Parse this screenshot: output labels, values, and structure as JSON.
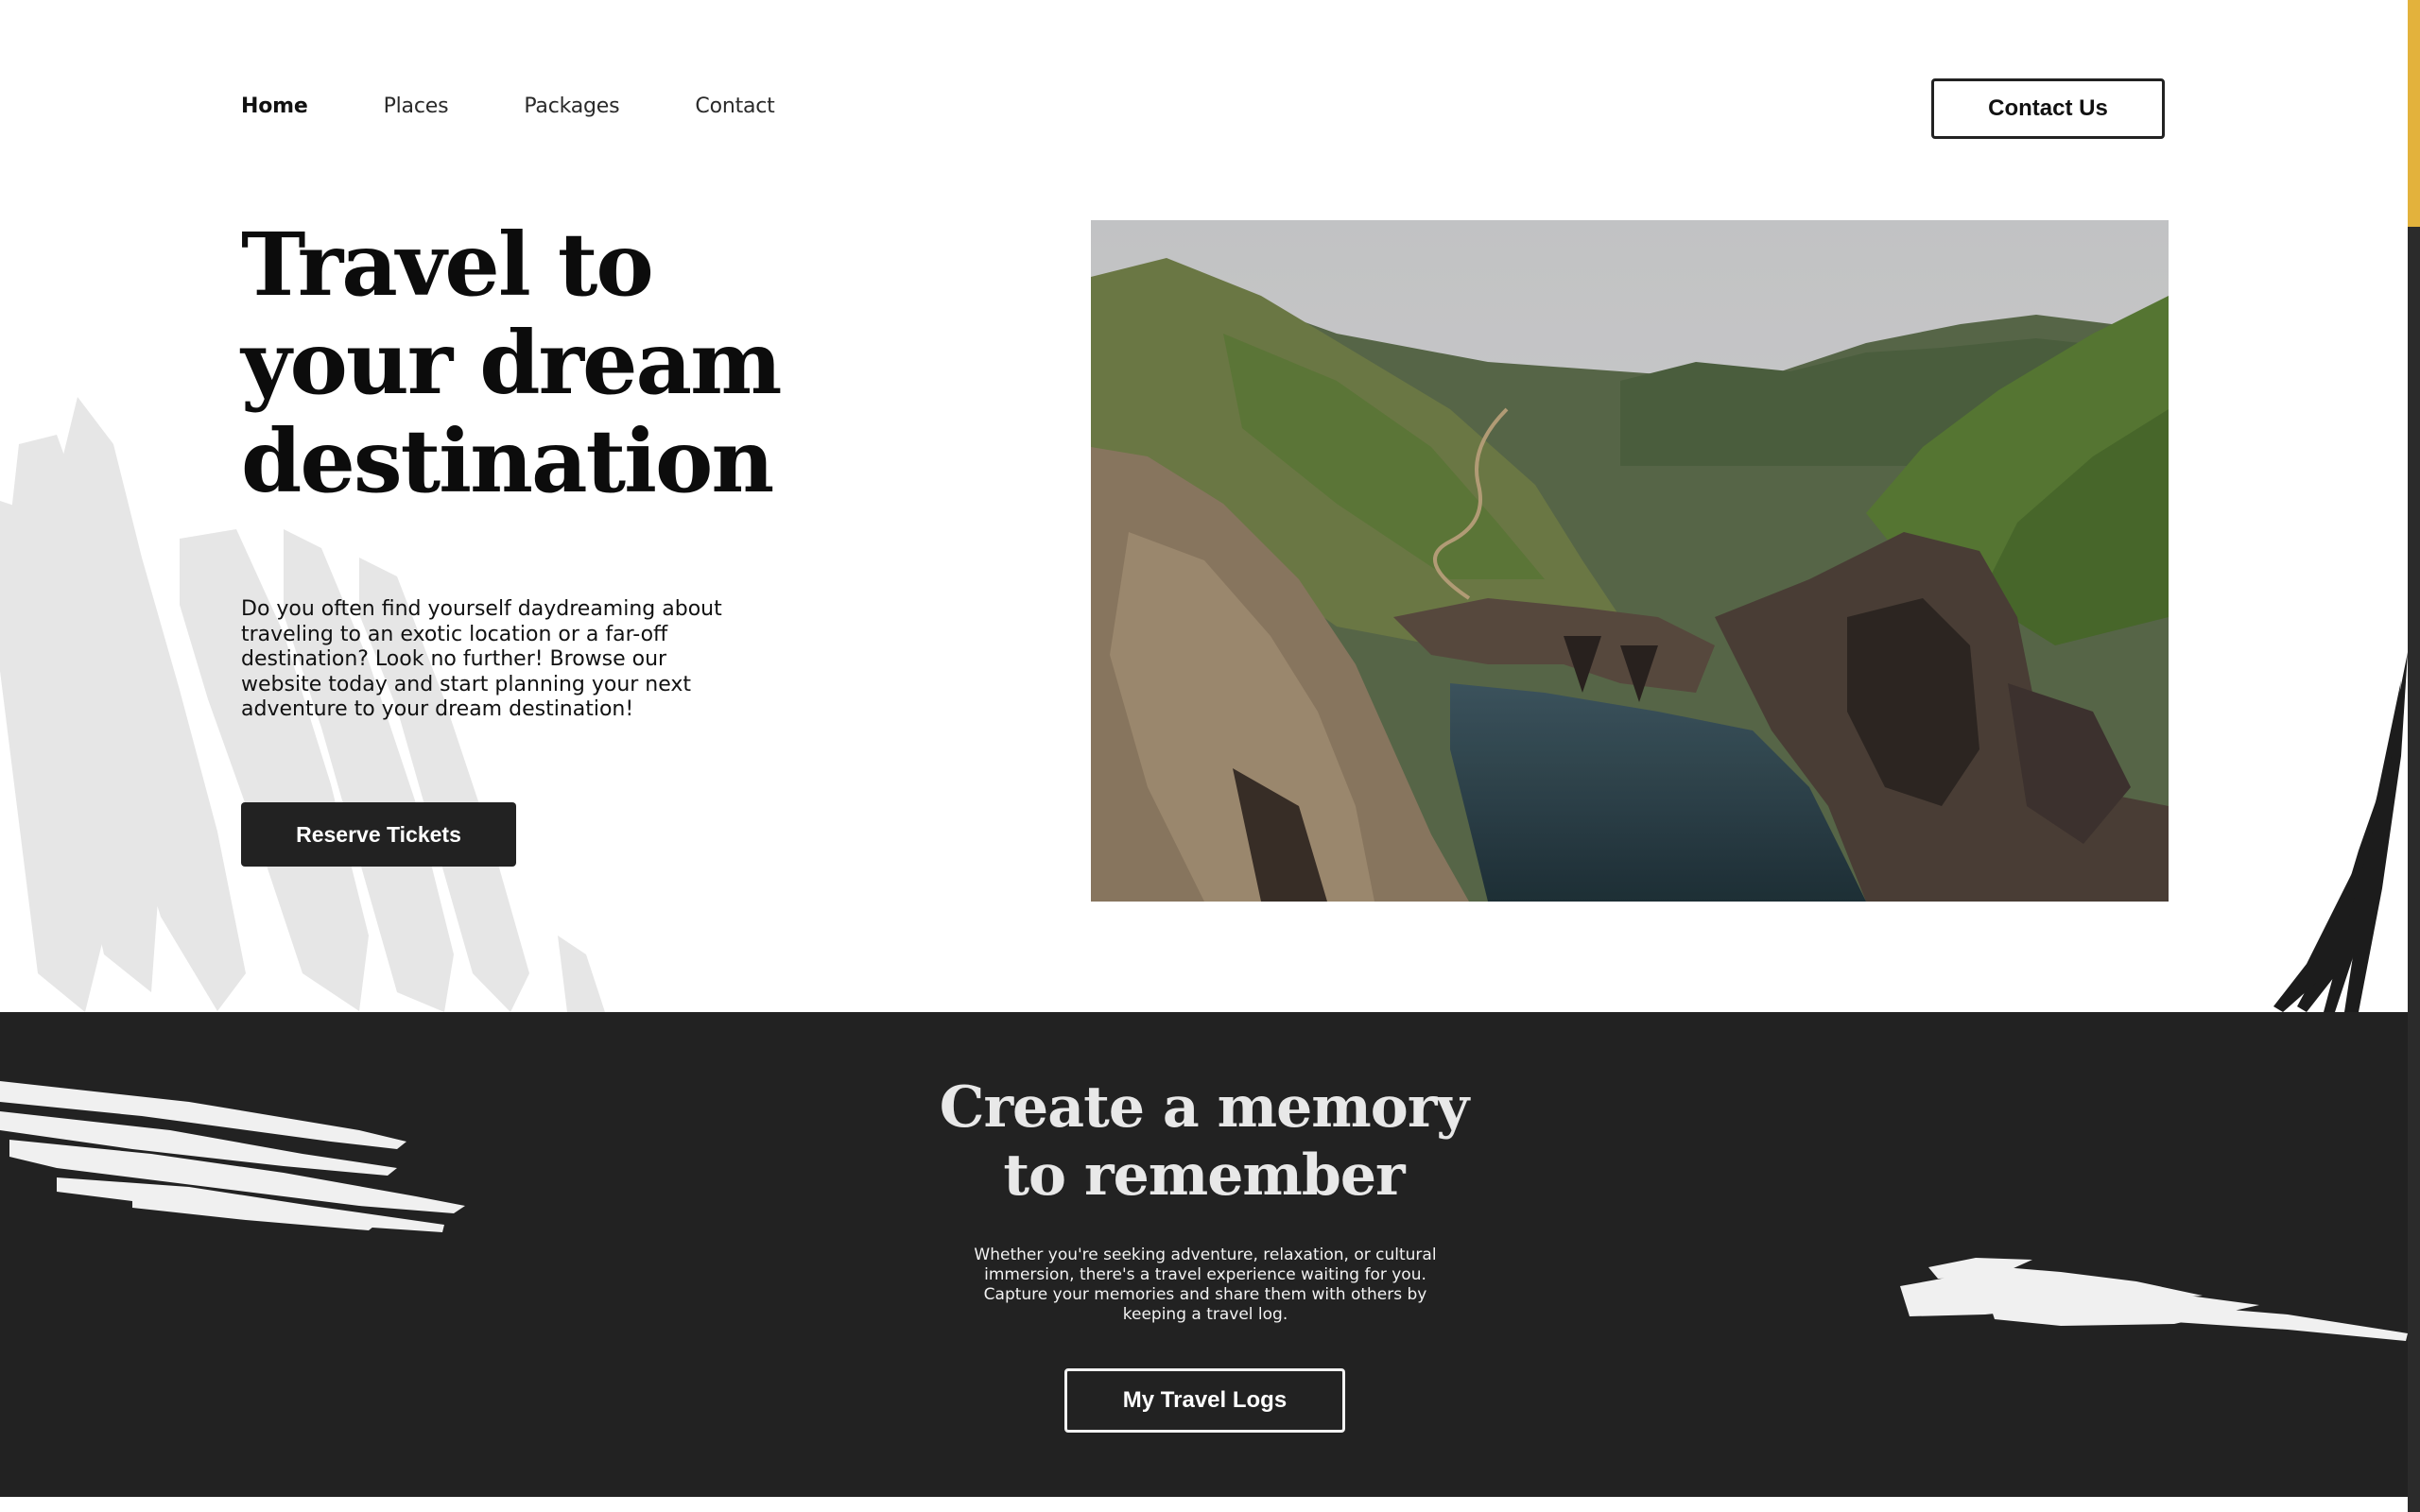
{
  "nav": {
    "links": [
      {
        "label": "Home",
        "active": true
      },
      {
        "label": "Places",
        "active": false
      },
      {
        "label": "Packages",
        "active": false
      },
      {
        "label": "Contact",
        "active": false
      }
    ],
    "contact_button": "Contact Us"
  },
  "hero": {
    "title_lines": [
      "Travel to",
      "your dream",
      "destination"
    ],
    "description": "Do you often find yourself daydreaming about traveling to an exotic location or a far-off destination? Look no further! Browse our website today and start planning your next adventure to your dream destination!",
    "cta_label": "Reserve Tickets",
    "image_alt": "coastal-cliffs-photo"
  },
  "memory": {
    "title_lines": [
      "Create a memory",
      "to remember"
    ],
    "description": "Whether you're seeking adventure, relaxation, or cultural immersion, there's a travel experience waiting for you. Capture your memories and share them with others by keeping a travel log.",
    "cta_label": "My Travel Logs"
  },
  "colors": {
    "dark": "#222222",
    "accent": "#e3b23c",
    "text": "#111111"
  }
}
